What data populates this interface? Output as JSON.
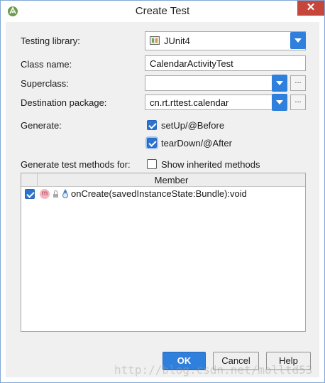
{
  "window": {
    "title": "Create Test",
    "close_glyph": "✕"
  },
  "form": {
    "testing_library": {
      "label": "Testing library:",
      "value": "JUnit4"
    },
    "class_name": {
      "label": "Class name:",
      "value": "CalendarActivityTest"
    },
    "superclass": {
      "label": "Superclass:",
      "value": "",
      "browse_label": "..."
    },
    "destination_package": {
      "label": "Destination package:",
      "value": "cn.rt.rttest.calendar",
      "browse_label": "..."
    },
    "generate": {
      "label": "Generate:",
      "options": [
        {
          "label": "setUp/@Before",
          "checked": true
        },
        {
          "label": "tearDown/@After",
          "checked": true
        }
      ]
    },
    "generate_methods": {
      "label": "Generate test methods for:"
    },
    "show_inherited": {
      "label": "Show inherited methods",
      "checked": false
    }
  },
  "table": {
    "header": "Member",
    "rows": [
      {
        "checked": true,
        "badge": "m",
        "text": "onCreate(savedInstanceState:Bundle):void"
      }
    ]
  },
  "buttons": {
    "ok": "OK",
    "cancel": "Cancel",
    "help": "Help"
  },
  "watermark": "http://blog.csdn.net/molltd53",
  "colors": {
    "accent": "#2f7fdc",
    "close": "#c7463b"
  }
}
